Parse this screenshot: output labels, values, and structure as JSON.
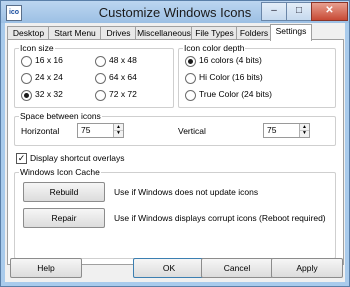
{
  "window": {
    "title": "Customize Windows Icons",
    "icon_text": "ico"
  },
  "titlebar_buttons": {
    "minimize": "–",
    "maximize": "□",
    "close": "✕"
  },
  "tabs": [
    {
      "label": "Desktop"
    },
    {
      "label": "Start Menu"
    },
    {
      "label": "Drives"
    },
    {
      "label": "Miscellaneous"
    },
    {
      "label": "File Types"
    },
    {
      "label": "Folders"
    },
    {
      "label": "Settings",
      "active": true
    }
  ],
  "icon_size": {
    "label": "Icon size",
    "options": [
      {
        "label": "16 x 16",
        "selected": false
      },
      {
        "label": "48 x 48",
        "selected": false
      },
      {
        "label": "24 x 24",
        "selected": false
      },
      {
        "label": "64 x 64",
        "selected": false
      },
      {
        "label": "32 x 32",
        "selected": true
      },
      {
        "label": "72 x 72",
        "selected": false
      }
    ]
  },
  "color_depth": {
    "label": "Icon color depth",
    "options": [
      {
        "label": "16 colors (4 bits)",
        "selected": true
      },
      {
        "label": "Hi Color (16 bits)",
        "selected": false
      },
      {
        "label": "True Color (24 bits)",
        "selected": false
      }
    ]
  },
  "spacing": {
    "label": "Space between icons",
    "horizontal_label": "Horizontal",
    "horizontal_value": "75",
    "vertical_label": "Vertical",
    "vertical_value": "75"
  },
  "shortcut_overlays": {
    "label": "Display shortcut overlays",
    "checked": true
  },
  "cache": {
    "label": "Windows Icon Cache",
    "rebuild_label": "Rebuild",
    "rebuild_desc": "Use if Windows does not update icons",
    "repair_label": "Repair",
    "repair_desc": "Use if Windows displays corrupt icons (Reboot required)"
  },
  "footer": {
    "help": "Help",
    "ok": "OK",
    "cancel": "Cancel",
    "apply": "Apply"
  }
}
